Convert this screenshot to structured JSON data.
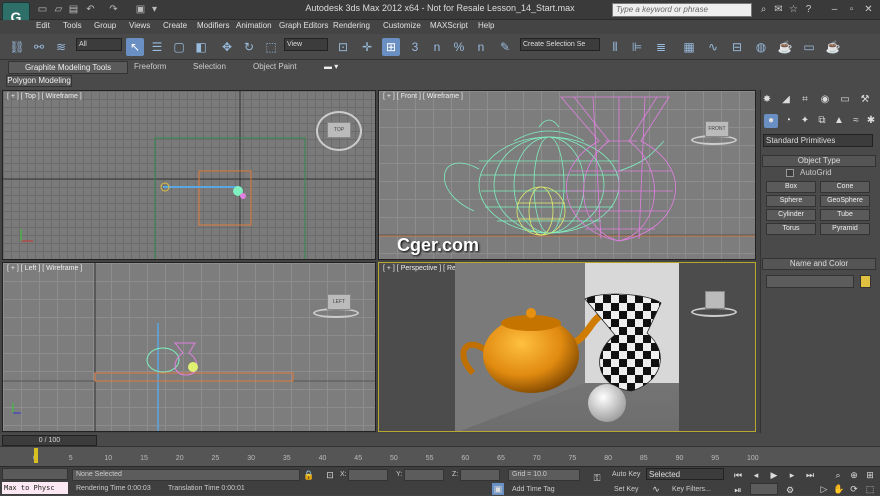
{
  "window": {
    "title": "Autodesk 3ds Max  2012 x64  - Not for Resale    Lesson_14_Start.max",
    "search_placeholder": "Type a keyword or phrase"
  },
  "menu": [
    "Edit",
    "Tools",
    "Group",
    "Views",
    "Create",
    "Modifiers",
    "Animation",
    "Graph Editors",
    "Rendering",
    "Customize",
    "MAXScript",
    "Help"
  ],
  "toolbar": {
    "selection_filter": "All",
    "ref_coord": "View",
    "named_selection": "Create Selection Se",
    "snap_labels": [
      "3",
      "n",
      "%",
      "n"
    ]
  },
  "ribbon": {
    "active_tab": "Graphite Modeling Tools",
    "tabs": [
      "Freeform",
      "Selection",
      "Object Paint"
    ],
    "panel": "Polygon Modeling"
  },
  "viewports": {
    "top": {
      "label": "[ + ] [ Top ] [ Wireframe ]",
      "cube": "TOP"
    },
    "front": {
      "label": "[ + ] [ Front ] [ Wireframe ]",
      "cube": "FRONT"
    },
    "left": {
      "label": "[ + ] [ Left ] [ Wireframe ]",
      "cube": "LEFT"
    },
    "persp": {
      "label": "[ + ] [ Perspective ] [ Realistic ]"
    },
    "watermark": "Cger.com"
  },
  "command_panel": {
    "category": "Standard Primitives",
    "object_type_header": "Object Type",
    "autogrid": "AutoGrid",
    "buttons": [
      "Box",
      "Cone",
      "Sphere",
      "GeoSphere",
      "Cylinder",
      "Tube",
      "Torus",
      "Pyramid"
    ],
    "name_color_header": "Name and Color",
    "name_color_swatch": "#e0c040"
  },
  "timeline": {
    "frame_display": "0 / 100",
    "ticks": [
      "0",
      "5",
      "10",
      "15",
      "20",
      "25",
      "30",
      "35",
      "40",
      "45",
      "50",
      "55",
      "60",
      "65",
      "70",
      "75",
      "80",
      "85",
      "90",
      "95",
      "100"
    ]
  },
  "status": {
    "maxscript": "Max to Physc",
    "selection": "None Selected",
    "render_time": "Rendering Time  0:00:03",
    "translation_time": "Translation Time  0:00:01",
    "x_label": "X:",
    "y_label": "Y:",
    "z_label": "Z:",
    "grid": "Grid = 10.0",
    "add_time_tag": "Add Time Tag",
    "auto_key": "Auto Key",
    "set_key": "Set Key",
    "key_mode": "Selected",
    "key_filters": "Key Filters..."
  },
  "colors": {
    "teapot_wire": "#7ff0c0",
    "vase_wire": "#e080e0",
    "sphere_wire": "#e0f070",
    "teapot_solid": "#e08a10"
  }
}
